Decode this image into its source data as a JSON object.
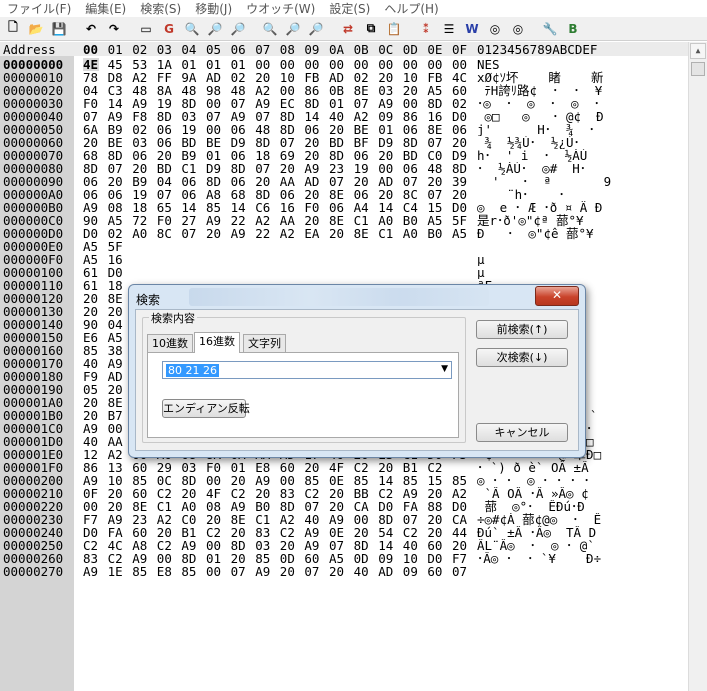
{
  "menu": [
    "ファイル(F)",
    "編集(E)",
    "検索(S)",
    "移動(J)",
    "ウオッチ(W)",
    "設定(S)",
    "ヘルプ(H)"
  ],
  "toolbar_icons": [
    {
      "name": "new-file-icon",
      "glyph": "🗋"
    },
    {
      "name": "open-folder-icon",
      "glyph": "📂"
    },
    {
      "name": "save-icon",
      "glyph": "💾"
    },
    {
      "name": "sep"
    },
    {
      "name": "undo-icon",
      "glyph": "↶"
    },
    {
      "name": "redo-icon",
      "glyph": "↷"
    },
    {
      "name": "sep"
    },
    {
      "name": "bookmark-icon",
      "glyph": "▭"
    },
    {
      "name": "goto-icon",
      "glyph": "G",
      "color": "#c0392b"
    },
    {
      "name": "search-icon",
      "glyph": "🔍"
    },
    {
      "name": "search-next-icon",
      "glyph": "🔎"
    },
    {
      "name": "search-prev-icon",
      "glyph": "🔎"
    },
    {
      "name": "sep"
    },
    {
      "name": "find-icon",
      "glyph": "🔍"
    },
    {
      "name": "find-next-icon",
      "glyph": "🔎"
    },
    {
      "name": "find-prev-icon",
      "glyph": "🔎"
    },
    {
      "name": "sep"
    },
    {
      "name": "replace-icon",
      "glyph": "⇄",
      "color": "#c0392b"
    },
    {
      "name": "compare-icon",
      "glyph": "⧉"
    },
    {
      "name": "copy-paste-icon",
      "glyph": "📋"
    },
    {
      "name": "sep"
    },
    {
      "name": "convert-icon",
      "glyph": "⁑",
      "color": "#c0392b"
    },
    {
      "name": "text-icon",
      "glyph": "☰"
    },
    {
      "name": "word-icon",
      "glyph": "W",
      "color": "#2a3fa8"
    },
    {
      "name": "watch-icon",
      "glyph": "◎"
    },
    {
      "name": "watch-next-icon",
      "glyph": "◎"
    },
    {
      "name": "sep"
    },
    {
      "name": "settings-icon",
      "glyph": "🔧"
    },
    {
      "name": "bookmark-b-icon",
      "glyph": "B",
      "color": "#2e7d32"
    }
  ],
  "header": {
    "address": "Address",
    "columns": [
      "00",
      "01",
      "02",
      "03",
      "04",
      "05",
      "06",
      "07",
      "08",
      "09",
      "0A",
      "0B",
      "0C",
      "0D",
      "0E",
      "0F"
    ],
    "ascii": "0123456789ABCDEF"
  },
  "rows": [
    {
      "addr": "00000000",
      "hex": [
        "4E",
        "45",
        "53",
        "1A",
        "01",
        "01",
        "01",
        "00",
        "00",
        "00",
        "00",
        "00",
        "00",
        "00",
        "00",
        "00"
      ],
      "ascii": "NES"
    },
    {
      "addr": "00000010",
      "hex": [
        "78",
        "D8",
        "A2",
        "FF",
        "9A",
        "AD",
        "02",
        "20",
        "10",
        "FB",
        "AD",
        "02",
        "20",
        "10",
        "FB",
        "4C"
      ],
      "ascii": "xØ¢ｿ坏    睹    新"
    },
    {
      "addr": "00000020",
      "hex": [
        "04",
        "C3",
        "48",
        "8A",
        "48",
        "98",
        "48",
        "A2",
        "00",
        "86",
        "0B",
        "8E",
        "03",
        "20",
        "A5",
        "60"
      ],
      "ascii": " ﾃH誇ﾘ路¢  ･  ･  ¥"
    },
    {
      "addr": "00000030",
      "hex": [
        "F0",
        "14",
        "A9",
        "19",
        "8D",
        "00",
        "07",
        "A9",
        "EC",
        "8D",
        "01",
        "07",
        "A9",
        "00",
        "8D",
        "02"
      ],
      "ascii": "･◎  ･  ◎  ･  ◎  ･"
    },
    {
      "addr": "00000040",
      "hex": [
        "07",
        "A9",
        "F8",
        "8D",
        "03",
        "07",
        "A9",
        "07",
        "8D",
        "14",
        "40",
        "A2",
        "09",
        "86",
        "16",
        "D0"
      ],
      "ascii": " ◎□   ◎   ･ @¢  Ð"
    },
    {
      "addr": "00000050",
      "hex": [
        "6A",
        "B9",
        "02",
        "06",
        "19",
        "00",
        "06",
        "48",
        "8D",
        "06",
        "20",
        "BE",
        "01",
        "06",
        "8E",
        "06"
      ],
      "ascii": "j'      H･  ¾  ･"
    },
    {
      "addr": "00000060",
      "hex": [
        "20",
        "BE",
        "03",
        "06",
        "BD",
        "BE",
        "D9",
        "8D",
        "07",
        "20",
        "BD",
        "BF",
        "D9",
        "8D",
        "07",
        "20"
      ],
      "ascii": " ¾  ½¾Ù･  ½¿Ù･"
    },
    {
      "addr": "00000070",
      "hex": [
        "68",
        "8D",
        "06",
        "20",
        "B9",
        "01",
        "06",
        "18",
        "69",
        "20",
        "8D",
        "06",
        "20",
        "BD",
        "C0",
        "D9"
      ],
      "ascii": "h･  ' i  ･  ½ÀÙ"
    },
    {
      "addr": "00000080",
      "hex": [
        "8D",
        "07",
        "20",
        "BD",
        "C1",
        "D9",
        "8D",
        "07",
        "20",
        "A9",
        "23",
        "19",
        "00",
        "06",
        "48",
        "8D"
      ],
      "ascii": "･  ½ÁÙ･  ◎#  H･"
    },
    {
      "addr": "00000090",
      "hex": [
        "06",
        "20",
        "B9",
        "04",
        "06",
        "8D",
        "06",
        "20",
        "AA",
        "AD",
        "07",
        "20",
        "AD",
        "07",
        "20",
        "39"
      ],
      "ascii": "  '   ･  ª       9"
    },
    {
      "addr": "000000A0",
      "hex": [
        "06",
        "06",
        "19",
        "07",
        "06",
        "A8",
        "68",
        "8D",
        "06",
        "20",
        "8E",
        "06",
        "20",
        "8C",
        "07",
        "20"
      ],
      "ascii": "    ¨h･    ･"
    },
    {
      "addr": "000000B0",
      "hex": [
        "A9",
        "08",
        "18",
        "65",
        "14",
        "85",
        "14",
        "C6",
        "16",
        "F0",
        "06",
        "A4",
        "14",
        "C4",
        "15",
        "D0"
      ],
      "ascii": "◎  e ･ Æ ･ð ¤ Ä Ð"
    },
    {
      "addr": "000000C0",
      "hex": [
        "90",
        "A5",
        "72",
        "F0",
        "27",
        "A9",
        "22",
        "A2",
        "AA",
        "20",
        "8E",
        "C1",
        "A0",
        "B0",
        "A5",
        "5F"
      ],
      "ascii": "是r･ð'◎\"¢ª 蔀°¥_"
    },
    {
      "addr": "000000D0",
      "hex": [
        "D0",
        "02",
        "A0",
        "8C",
        "07",
        "20",
        "A9",
        "22",
        "A2",
        "EA",
        "20",
        "8E",
        "C1",
        "A0",
        "B0",
        "A5"
      ],
      "ascii": "Ð   ･  ◎\"¢ê 蔀°¥"
    },
    {
      "addr": "000000E0",
      "hex": [
        "A5",
        "5F",
        "",
        "",
        "",
        "",
        "",
        "",
        "",
        "",
        "",
        "",
        "",
        "",
        "",
        ""
      ],
      "ascii": ""
    },
    {
      "addr": "000000F0",
      "hex": [
        "A5",
        "16",
        "",
        "",
        "",
        "",
        "",
        "",
        "",
        "",
        "",
        "",
        "",
        "",
        "",
        ""
      ],
      "ascii": "µ"
    },
    {
      "addr": "00000100",
      "hex": [
        "61",
        "D0",
        "",
        "",
        "",
        "",
        "",
        "",
        "",
        "",
        "",
        "",
        "",
        "",
        "",
        ""
      ],
      "ascii": "µ"
    },
    {
      "addr": "00000110",
      "hex": [
        "61",
        "18",
        "",
        "",
        "",
        "",
        "",
        "",
        "",
        "",
        "",
        "",
        "",
        "",
        "",
        ""
      ],
      "ascii": "ªF"
    },
    {
      "addr": "00000120",
      "hex": [
        "20",
        "8E",
        "",
        "",
        "",
        "",
        "",
        "",
        "",
        "",
        "",
        "",
        "",
        "",
        "",
        ""
      ],
      "ascii": "･"
    },
    {
      "addr": "00000130",
      "hex": [
        "20",
        "20",
        "",
        "",
        "",
        "",
        "",
        "",
        "",
        "",
        "",
        "",
        "",
        "",
        "",
        ""
      ],
      "ascii": "ｨ"
    },
    {
      "addr": "00000140",
      "hex": [
        "90",
        "04",
        "",
        "",
        "",
        "",
        "",
        "",
        "",
        "",
        "",
        "",
        "",
        "",
        "",
        ""
      ],
      "ascii": "3"
    },
    {
      "addr": "00000150",
      "hex": [
        "E6",
        "A5",
        "",
        "",
        "",
        "",
        "",
        "",
        "",
        "",
        "",
        "",
        "",
        "",
        "",
        ""
      ],
      "ascii": "ｾ"
    },
    {
      "addr": "00000160",
      "hex": [
        "85",
        "38",
        "",
        "",
        "",
        "",
        "",
        "",
        "",
        "",
        "",
        "",
        "",
        "",
        "",
        ""
      ],
      "ascii": "◎"
    },
    {
      "addr": "00000170",
      "hex": [
        "40",
        "A9",
        "",
        "",
        "",
        "",
        "",
        "",
        "",
        "",
        "",
        "",
        "",
        "",
        "",
        ""
      ],
      "ascii": "@Ð"
    },
    {
      "addr": "00000180",
      "hex": [
        "F9",
        "AD",
        "",
        "",
        "",
        "",
        "",
        "",
        "",
        "",
        "",
        "",
        "",
        "",
        "",
        ""
      ],
      "ascii": ""
    },
    {
      "addr": "00000190",
      "hex": [
        "05",
        "20",
        "A9",
        "05",
        "45",
        "DB",
        "85",
        "DB",
        "68",
        "A8",
        "68",
        "AA",
        "68",
        "40",
        "8D",
        "06"
      ],
      "ascii": " ◎ EÛ･Ûh¨hªh@"
    },
    {
      "addr": "000001A0",
      "hex": [
        "20",
        "8E",
        "06",
        "20",
        "60",
        "20",
        "B7",
        "C1",
        "A5",
        "12",
        "85",
        "10",
        "A5",
        "13",
        "85",
        "11"
      ],
      "ascii": "  ` ·Á¥ ･ ¥ ･"
    },
    {
      "addr": "000001B0",
      "hex": [
        "20",
        "B7",
        "C1",
        "A5",
        "12",
        "C5",
        "10",
        "D0",
        "07",
        "A5",
        "13",
        "C5",
        "11",
        "D0",
        "01",
        "60"
      ],
      "ascii": " ·Á¥ Å Ð ¥ Å Ð `"
    },
    {
      "addr": "000001C0",
      "hex": [
        "A9",
        "00",
        "85",
        "12",
        "85",
        "13",
        "60",
        "A9",
        "01",
        "8D",
        "16",
        "40",
        "A9",
        "00",
        "8D",
        "16"
      ],
      "ascii": "◎ ･ ･ `◎ ･ @◎  ･"
    },
    {
      "addr": "000001D0",
      "hex": [
        "40",
        "AA",
        "A0",
        "08",
        "8A",
        "0A",
        "AA",
        "AD",
        "16",
        "40",
        "20",
        "E3",
        "C1",
        "D0",
        "F5",
        "86"
      ],
      "ascii": "@ª  ･  ª  @ 翠Ð□"
    },
    {
      "addr": "000001E0",
      "hex": [
        "12",
        "A2",
        "00",
        "A0",
        "08",
        "8A",
        "0A",
        "AA",
        "AD",
        "17",
        "40",
        "20",
        "E3",
        "C1",
        "D0",
        "F5"
      ],
      "ascii": " ¢   ･  ª  @ 翠Ð□"
    },
    {
      "addr": "000001F0",
      "hex": [
        "86",
        "13",
        "60",
        "29",
        "03",
        "F0",
        "01",
        "E8",
        "60",
        "20",
        "4F",
        "C2",
        "20",
        "B1",
        "C2"
      ],
      "ascii": "･ `) ð è` OÂ ±Â"
    },
    {
      "addr": "00000200",
      "hex": [
        "A9",
        "10",
        "85",
        "0C",
        "8D",
        "00",
        "20",
        "A9",
        "00",
        "85",
        "0E",
        "85",
        "14",
        "85",
        "15",
        "85"
      ],
      "ascii": "◎ ･ ･  ◎ ･ ･ ･ ･"
    },
    {
      "addr": "00000210",
      "hex": [
        "0F",
        "20",
        "60",
        "C2",
        "20",
        "4F",
        "C2",
        "20",
        "83",
        "C2",
        "20",
        "BB",
        "C2",
        "A9",
        "20",
        "A2"
      ],
      "ascii": " `Â OÂ ･Â »Â◎ ¢"
    },
    {
      "addr": "00000220",
      "hex": [
        "00",
        "20",
        "8E",
        "C1",
        "A0",
        "08",
        "A9",
        "B0",
        "8D",
        "07",
        "20",
        "CA",
        "D0",
        "FA",
        "88",
        "D0"
      ],
      "ascii": " 蔀  ◎°･  ÊÐú･Ð"
    },
    {
      "addr": "00000230",
      "hex": [
        "F7",
        "A9",
        "23",
        "A2",
        "C0",
        "20",
        "8E",
        "C1",
        "A2",
        "40",
        "A9",
        "00",
        "8D",
        "07",
        "20",
        "CA"
      ],
      "ascii": "÷◎#¢À 蔀¢@◎  ･  Ê"
    },
    {
      "addr": "00000240",
      "hex": [
        "D0",
        "FA",
        "60",
        "20",
        "B1",
        "C2",
        "20",
        "83",
        "C2",
        "A9",
        "0E",
        "20",
        "54",
        "C2",
        "20",
        "44"
      ],
      "ascii": "Ðú` ±Â ･Â◎  TÂ D"
    },
    {
      "addr": "00000250",
      "hex": [
        "C2",
        "4C",
        "A8",
        "C2",
        "A9",
        "00",
        "8D",
        "03",
        "20",
        "A9",
        "07",
        "8D",
        "14",
        "40",
        "60",
        "20"
      ],
      "ascii": "ÂL¨Â◎  ･  ◎ ･ @`"
    },
    {
      "addr": "00000260",
      "hex": [
        "83",
        "C2",
        "A9",
        "00",
        "8D",
        "01",
        "20",
        "85",
        "0D",
        "60",
        "A5",
        "0D",
        "09",
        "10",
        "D0",
        "F7"
      ],
      "ascii": "･Â◎ ･  ･ `¥    Ð÷"
    },
    {
      "addr": "00000270",
      "hex": [
        "A9",
        "1E",
        "85",
        "E8",
        "85",
        "00",
        "07",
        "A9",
        "20",
        "07",
        "20",
        "40",
        "AD",
        "09",
        "60",
        "07"
      ],
      "ascii": ""
    }
  ],
  "dialog": {
    "title": "検索",
    "close": "✕",
    "group_label": "検索内容",
    "tabs": [
      "10進数",
      "16進数",
      "文字列"
    ],
    "active_tab": 1,
    "search_value": "80 21 26",
    "endian_button": "エンディアン反転",
    "prev_button": "前検索(↑)",
    "next_button": "次検索(↓)",
    "cancel_button": "キャンセル"
  }
}
